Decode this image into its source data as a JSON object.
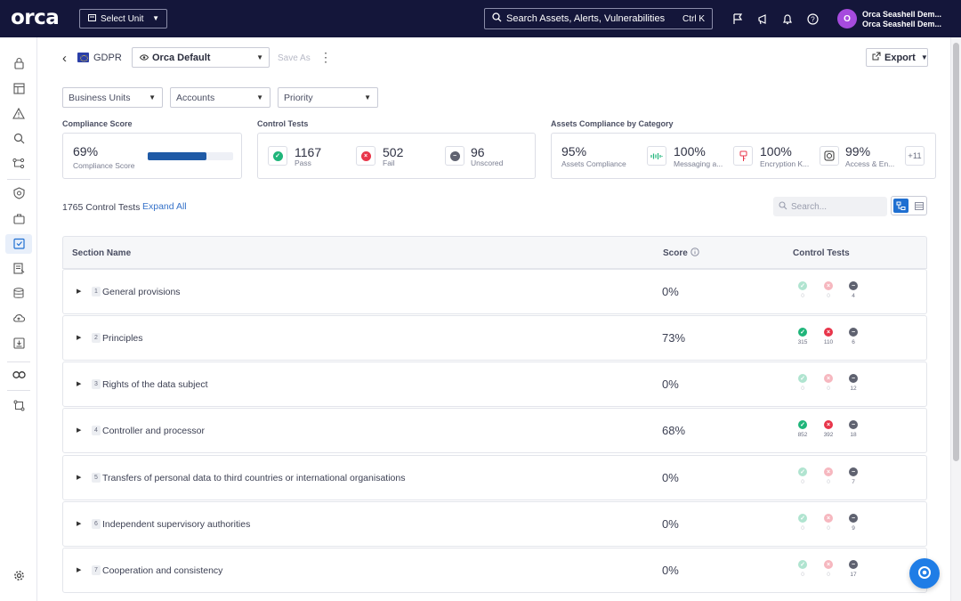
{
  "app": {
    "logo": "orca"
  },
  "topbar": {
    "select_unit": "Select Unit",
    "search_placeholder": "Search Assets, Alerts, Vulnerabilities",
    "search_shortcut": "Ctrl K",
    "user_initial": "O",
    "user_line1": "Orca Seashell Dem...",
    "user_line2": "Orca Seashell Dem..."
  },
  "header": {
    "title": "GDPR",
    "view": "Orca Default",
    "save_as": "Save As",
    "export": "Export"
  },
  "filters": [
    "Business Units",
    "Accounts",
    "Priority"
  ],
  "compliance": {
    "label": "Compliance Score",
    "value": "69%",
    "sublabel": "Compliance Score",
    "progress": 0.69
  },
  "control_tests": {
    "label": "Control Tests",
    "pass": "1167",
    "pass_label": "Pass",
    "fail": "502",
    "fail_label": "Fail",
    "unscored": "96",
    "unscored_label": "Unscored"
  },
  "assets": {
    "label": "Assets Compliance by Category",
    "overall_value": "95%",
    "overall_label": "Assets Compliance",
    "cat1_value": "100%",
    "cat1_label": "Messaging a...",
    "cat2_value": "100%",
    "cat2_label": "Encryption K...",
    "cat3_value": "99%",
    "cat3_label": "Access & En...",
    "more": "+11"
  },
  "tests_toolbar": {
    "count": "1765 Control Tests",
    "expand_all": "Expand All",
    "search_placeholder": "Search..."
  },
  "table": {
    "col_section": "Section Name",
    "col_score": "Score",
    "col_tests": "Control Tests",
    "rows": [
      {
        "num": "1",
        "name": "General provisions",
        "score": "0%",
        "pass": "0",
        "fail": "0",
        "unscored": "4"
      },
      {
        "num": "2",
        "name": "Principles",
        "score": "73%",
        "pass": "315",
        "fail": "110",
        "unscored": "6"
      },
      {
        "num": "3",
        "name": "Rights of the data subject",
        "score": "0%",
        "pass": "0",
        "fail": "0",
        "unscored": "12"
      },
      {
        "num": "4",
        "name": "Controller and processor",
        "score": "68%",
        "pass": "852",
        "fail": "392",
        "unscored": "18"
      },
      {
        "num": "5",
        "name": "Transfers of personal data to third countries or international organisations",
        "score": "0%",
        "pass": "0",
        "fail": "0",
        "unscored": "7"
      },
      {
        "num": "6",
        "name": "Independent supervisory authorities",
        "score": "0%",
        "pass": "0",
        "fail": "0",
        "unscored": "9"
      },
      {
        "num": "7",
        "name": "Cooperation and consistency",
        "score": "0%",
        "pass": "0",
        "fail": "0",
        "unscored": "17"
      }
    ]
  },
  "colors": {
    "topbar": "#14163a",
    "accent": "#1f6fd1",
    "pass": "#1fb57a",
    "fail": "#e8354a",
    "unscored": "#5f6270",
    "avatar": "#a64bde"
  }
}
